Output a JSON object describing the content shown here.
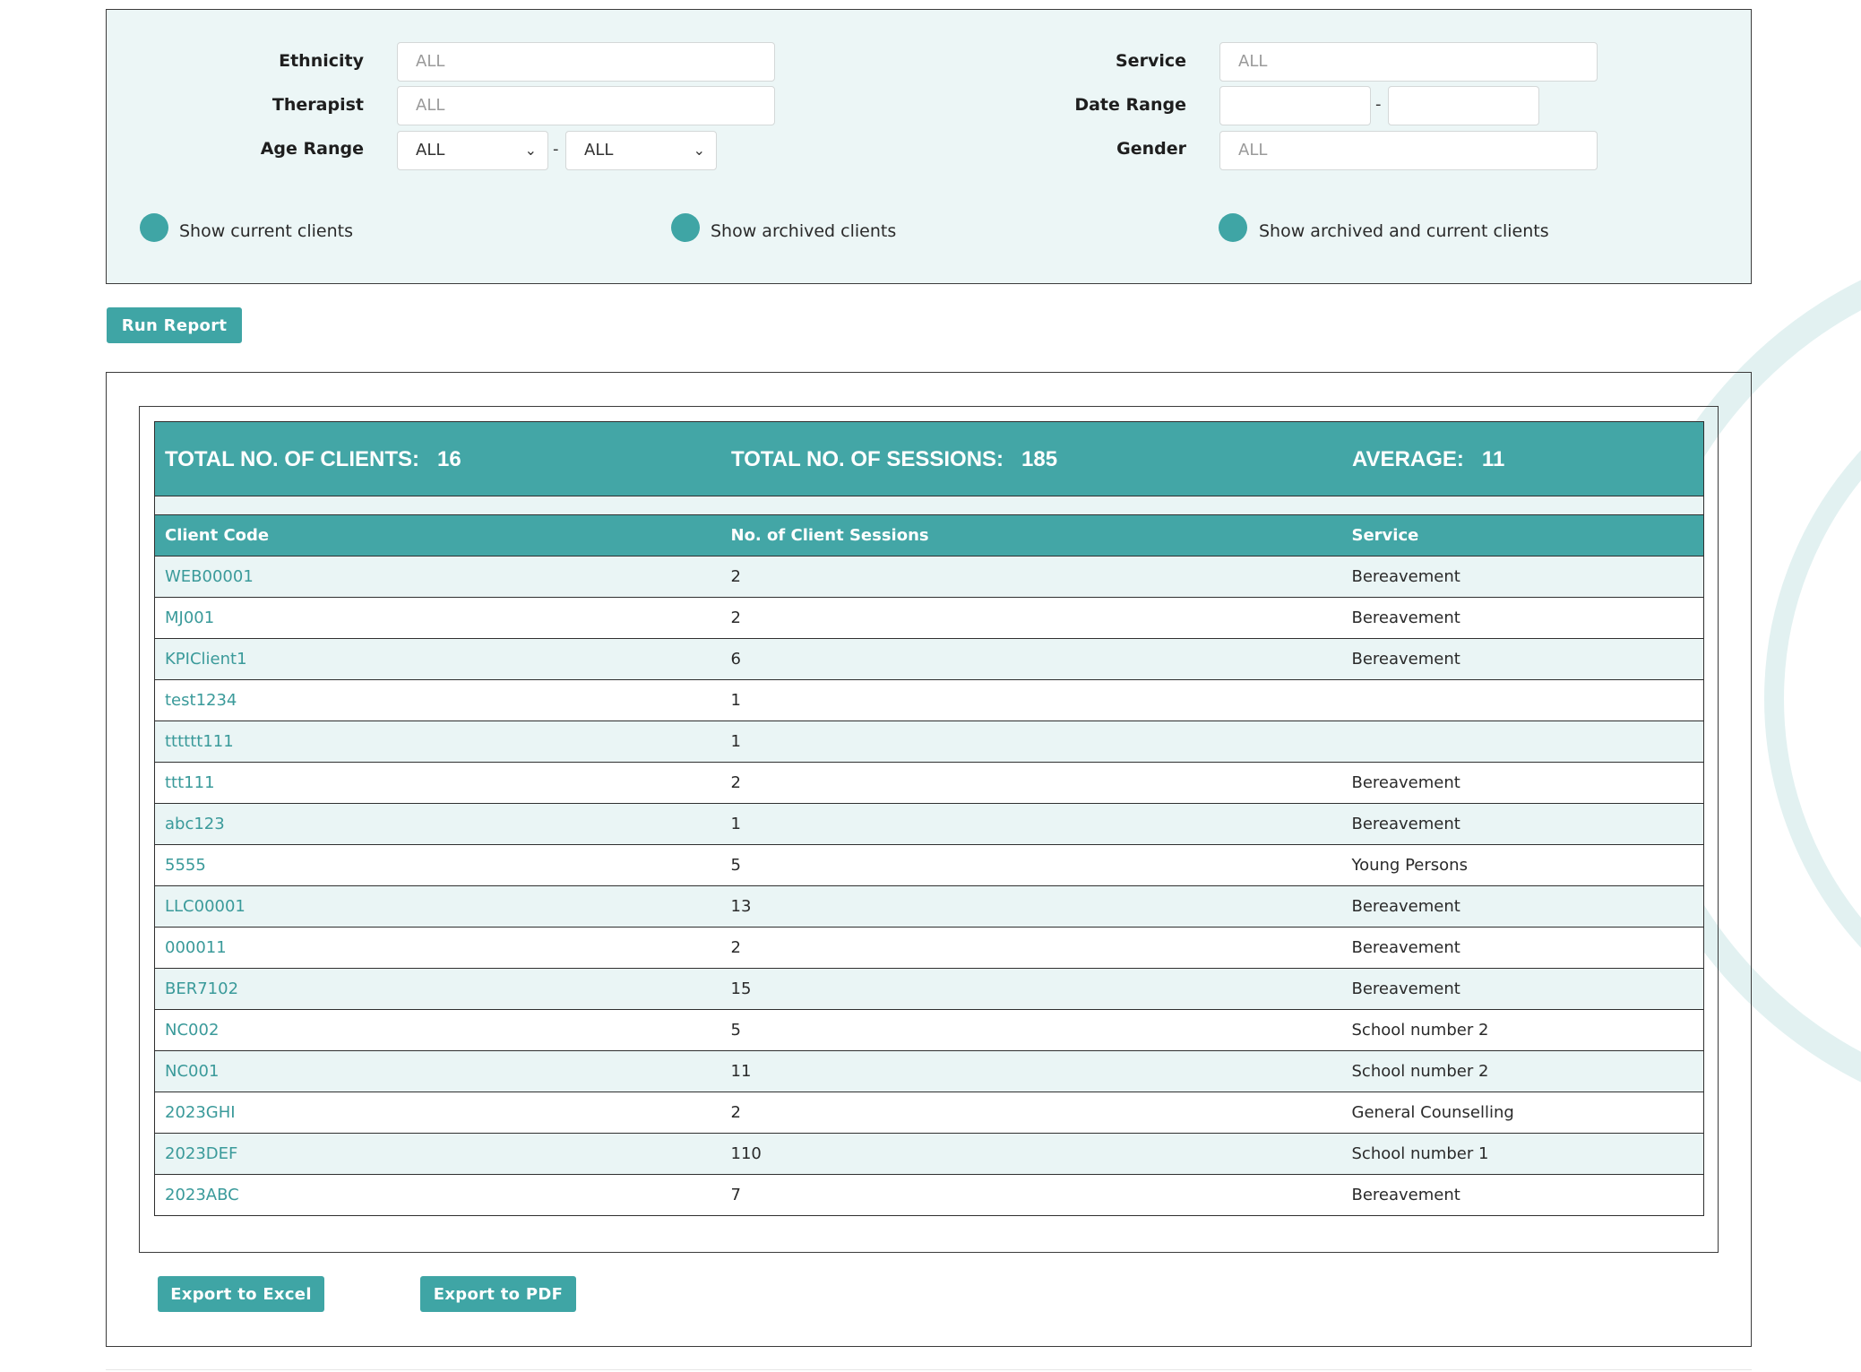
{
  "colors": {
    "accent": "#43a6a6",
    "panel_bg": "#ecf6f6",
    "row_alt": "#eaf5f5",
    "link": "#3a9a9a"
  },
  "filters": {
    "ethnicity": {
      "label": "Ethnicity",
      "placeholder": "ALL"
    },
    "therapist": {
      "label": "Therapist",
      "placeholder": "ALL"
    },
    "age_range": {
      "label": "Age Range",
      "from": "ALL",
      "to": "ALL",
      "separator": "-"
    },
    "service": {
      "label": "Service",
      "placeholder": "ALL"
    },
    "date_range": {
      "label": "Date Range",
      "from": "",
      "to": "",
      "separator": "-"
    },
    "gender": {
      "label": "Gender",
      "placeholder": "ALL"
    }
  },
  "client_options": [
    {
      "label": "Show current clients"
    },
    {
      "label": "Show archived clients"
    },
    {
      "label": "Show archived and current clients"
    }
  ],
  "run_report_label": "Run Report",
  "summary": {
    "clients_label": "TOTAL NO. OF CLIENTS:",
    "clients_value": "16",
    "sessions_label": "TOTAL NO. OF SESSIONS:",
    "sessions_value": "185",
    "average_label": "AVERAGE:",
    "average_value": "11"
  },
  "table": {
    "headers": [
      "Client Code",
      "No. of Client Sessions",
      "Service"
    ],
    "rows": [
      {
        "code": "WEB00001",
        "sessions": "2",
        "service": "Bereavement"
      },
      {
        "code": "MJ001",
        "sessions": "2",
        "service": "Bereavement"
      },
      {
        "code": "KPIClient1",
        "sessions": "6",
        "service": "Bereavement"
      },
      {
        "code": "test1234",
        "sessions": "1",
        "service": ""
      },
      {
        "code": "tttttt111",
        "sessions": "1",
        "service": ""
      },
      {
        "code": "ttt111",
        "sessions": "2",
        "service": "Bereavement"
      },
      {
        "code": "abc123",
        "sessions": "1",
        "service": "Bereavement"
      },
      {
        "code": "5555",
        "sessions": "5",
        "service": "Young Persons"
      },
      {
        "code": "LLC00001",
        "sessions": "13",
        "service": "Bereavement"
      },
      {
        "code": "000011",
        "sessions": "2",
        "service": "Bereavement"
      },
      {
        "code": "BER7102",
        "sessions": "15",
        "service": "Bereavement"
      },
      {
        "code": "NC002",
        "sessions": "5",
        "service": "School number 2"
      },
      {
        "code": "NC001",
        "sessions": "11",
        "service": "School number 2"
      },
      {
        "code": "2023GHI",
        "sessions": "2",
        "service": "General Counselling"
      },
      {
        "code": "2023DEF",
        "sessions": "110",
        "service": "School number 1"
      },
      {
        "code": "2023ABC",
        "sessions": "7",
        "service": "Bereavement"
      }
    ]
  },
  "export_excel_label": "Export to Excel",
  "export_pdf_label": "Export to PDF"
}
